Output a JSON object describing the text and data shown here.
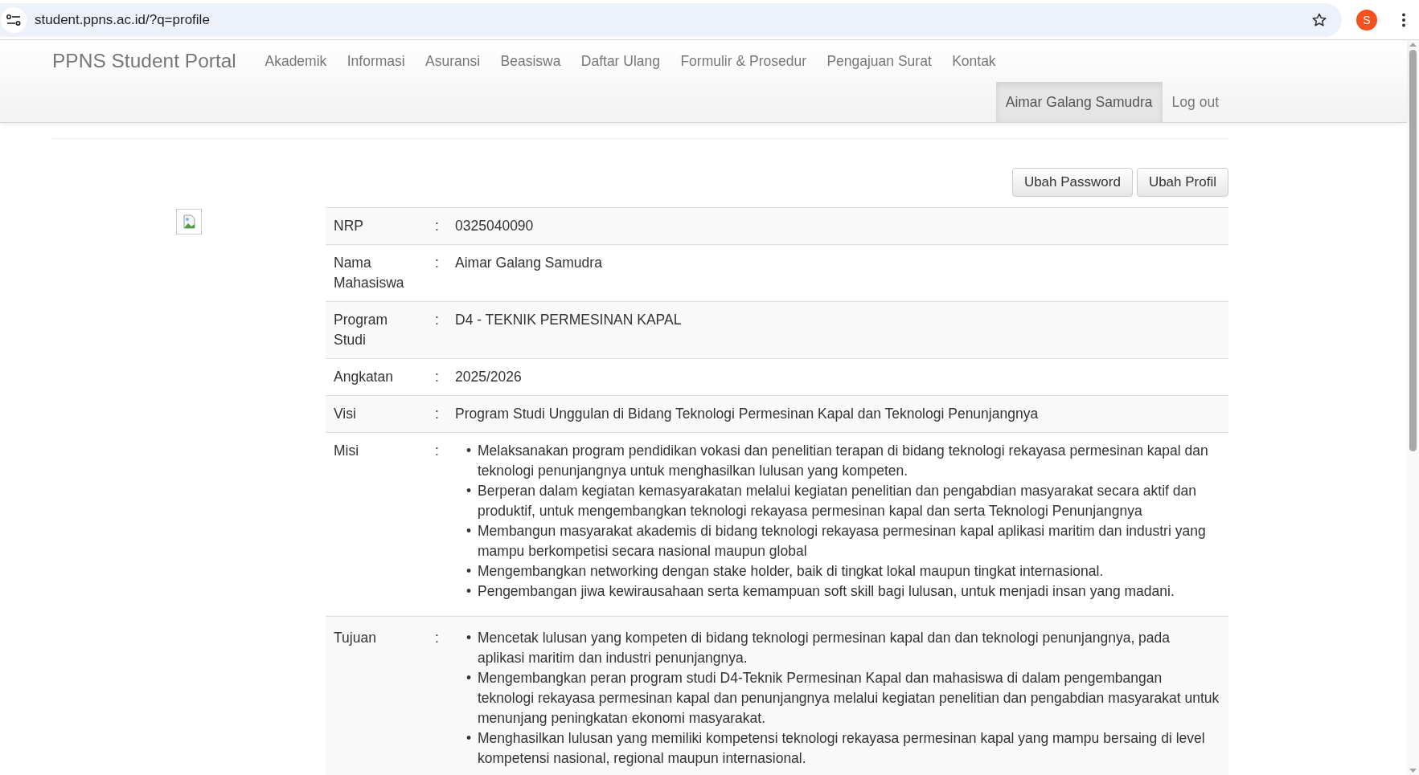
{
  "browser": {
    "url": "student.ppns.ac.id/?q=profile",
    "avatar_letter": "S"
  },
  "navbar": {
    "brand": "PPNS Student Portal",
    "items": [
      "Akademik",
      "Informasi",
      "Asuransi",
      "Beasiswa",
      "Daftar Ulang",
      "Formulir & Prosedur",
      "Pengajuan Surat",
      "Kontak"
    ],
    "user_items": [
      {
        "label": "Aimar Galang Samudra",
        "selected": true
      },
      {
        "label": "Log out",
        "selected": false
      }
    ]
  },
  "buttons": [
    "Ubah Password",
    "Ubah Profil"
  ],
  "profile": {
    "rows": [
      {
        "label": "NRP",
        "separator": ":",
        "value": "0325040090"
      },
      {
        "label": "Nama Mahasiswa",
        "separator": ":",
        "value": "Aimar Galang Samudra"
      },
      {
        "label": "Program Studi",
        "separator": ":",
        "value": "D4 - TEKNIK PERMESINAN KAPAL"
      },
      {
        "label": "Angkatan",
        "separator": ":",
        "value": "2025/2026"
      },
      {
        "label": "Visi",
        "separator": ":",
        "value": "Program Studi Unggulan di Bidang Teknologi Permesinan Kapal dan Teknologi Penunjangnya"
      },
      {
        "label": "Misi",
        "separator": ":",
        "marker": "•",
        "items": [
          "Melaksanakan program pendidikan vokasi dan penelitian terapan di bidang teknologi rekayasa permesinan kapal dan teknologi penunjangnya untuk menghasilkan lulusan yang kompeten.",
          "Berperan dalam kegiatan kemasyarakatan melalui kegiatan penelitian dan pengabdian masyarakat secara aktif dan produktif, untuk mengembangkan teknologi rekayasa permesinan kapal dan serta Teknologi Penunjangnya",
          "Membangun masyarakat akademis di bidang teknologi rekayasa permesinan kapal aplikasi maritim dan industri yang mampu berkompetisi secara nasional maupun global",
          "Mengembangkan networking dengan stake holder, baik di tingkat lokal maupun tingkat internasional.",
          "Pengembangan jiwa kewirausahaan serta kemampuan soft skill bagi lulusan, untuk menjadi insan yang madani."
        ]
      },
      {
        "label": "Tujuan",
        "separator": ":",
        "marker": "•",
        "items": [
          "Mencetak lulusan yang kompeten di bidang teknologi permesinan kapal dan dan teknologi penunjangnya, pada aplikasi maritim dan industri penunjangnya.",
          "Mengembangkan peran program studi D4-Teknik Permesinan Kapal dan mahasiswa di dalam pengembangan teknologi rekayasa permesinan kapal dan penunjangnya melalui kegiatan penelitian dan pengabdian masyarakat untuk menunjang peningkatan ekonomi masyarakat.",
          "Menghasilkan lulusan yang memiliki kompetensi teknologi rekayasa permesinan kapal yang mampu bersaing di level kompetensi nasional, regional maupun internasional."
        ]
      }
    ]
  }
}
